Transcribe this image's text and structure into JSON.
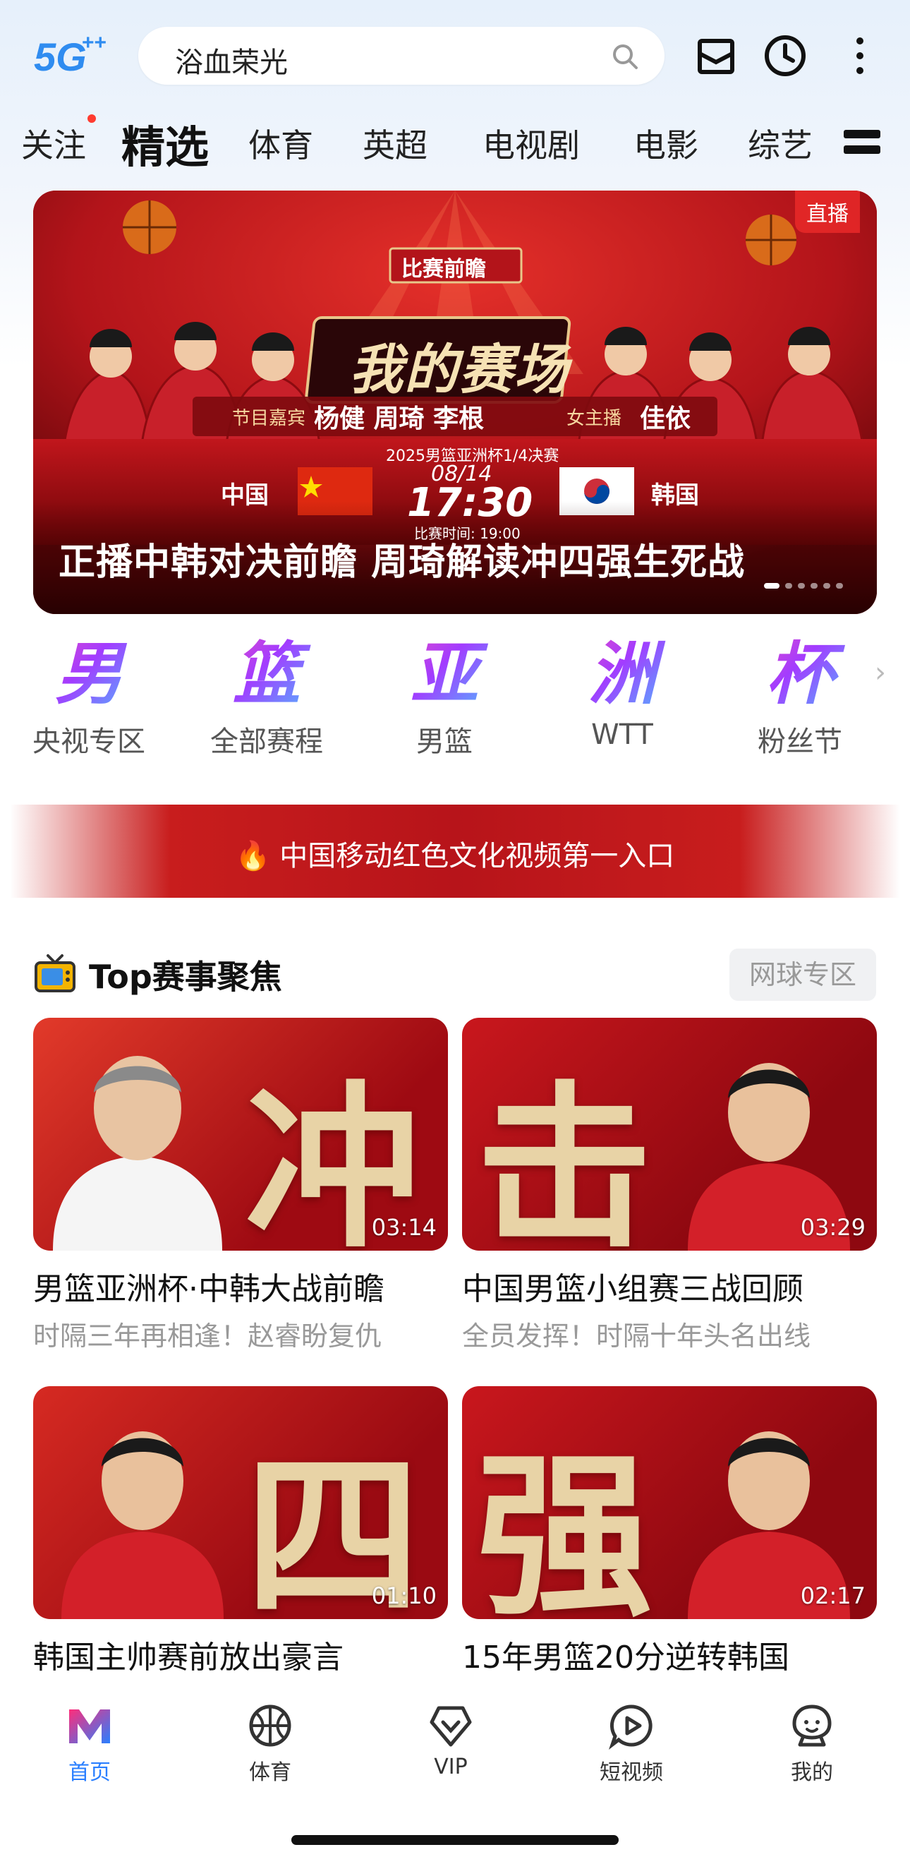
{
  "header": {
    "network_badge": "5G",
    "network_badge_plus": "++",
    "search_query": "浴血荣光"
  },
  "tabs": [
    {
      "label": "关注",
      "has_dot": true
    },
    {
      "label": "精选",
      "active": true
    },
    {
      "label": "体育"
    },
    {
      "label": "英超"
    },
    {
      "label": "电视剧"
    },
    {
      "label": "电影"
    },
    {
      "label": "综艺"
    }
  ],
  "banner": {
    "live_badge": "直播",
    "show_name": "我的赛场",
    "show_tag": "比赛前瞻",
    "guests_label": "节目嘉宾",
    "guests": "杨健 周琦 李根",
    "host_label": "女主播",
    "host": "佳依",
    "event": "2025男篮亚洲杯1/4决赛",
    "date": "08/14",
    "time": "17:30",
    "match_time_label": "比赛时间: 19:00",
    "team_home": "中国",
    "team_away": "韩国",
    "caption": "正播中韩对决前瞻 周琦解读冲四强生死战",
    "slides_total": 6,
    "slide_active": 1
  },
  "quick_entries": [
    {
      "glyph": "男",
      "label": "央视专区"
    },
    {
      "glyph": "篮",
      "label": "全部赛程"
    },
    {
      "glyph": "亚",
      "label": "男篮"
    },
    {
      "glyph": "洲",
      "label": "WTT"
    },
    {
      "glyph": "杯",
      "label": "粉丝节"
    }
  ],
  "promo": {
    "text": "中国移动红色文化视频第一入口"
  },
  "section": {
    "title": "Top赛事聚焦",
    "button": "网球专区"
  },
  "cards": [
    {
      "big_char": "冲",
      "duration": "03:14",
      "title": "男篮亚洲杯·中韩大战前瞻",
      "subtitle": "时隔三年再相逢！赵睿盼复仇"
    },
    {
      "big_char": "击",
      "duration": "03:29",
      "title": "中国男篮小组赛三战回顾",
      "subtitle": "全员发挥！时隔十年头名出线"
    },
    {
      "big_char": "四",
      "duration": "01:10",
      "title": "韩国主帅赛前放出豪言",
      "subtitle": ""
    },
    {
      "big_char": "强",
      "duration": "02:17",
      "title": "15年男篮20分逆转韩国",
      "subtitle": ""
    }
  ],
  "bottom_nav": [
    {
      "label": "首页",
      "icon": "home-logo-icon",
      "active": true
    },
    {
      "label": "体育",
      "icon": "basketball-icon"
    },
    {
      "label": "VIP",
      "icon": "vip-diamond-icon"
    },
    {
      "label": "短视频",
      "icon": "play-bubble-icon"
    },
    {
      "label": "我的",
      "icon": "profile-icon"
    }
  ],
  "colors": {
    "accent_blue": "#2a7fff",
    "banner_red": "#b31218",
    "gold": "#e8d3a6"
  }
}
